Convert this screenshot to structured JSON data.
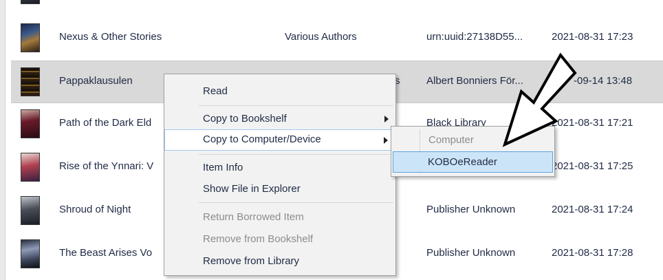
{
  "rows": [
    {
      "title": "Nexus & Other Stories",
      "author": "Various Authors",
      "publisher": "urn:uuid:27138D55...",
      "date": "2021-08-31 17:23"
    },
    {
      "title": "Pappaklausulen",
      "author": "s",
      "publisher": "Albert Bonniers För...",
      "date": "-09-14 13:48"
    },
    {
      "title": "Path of the Dark Eld",
      "author": "",
      "publisher": "Black Library",
      "date": "2021-08-31 17:21"
    },
    {
      "title": "Rise of the Ynnari: V",
      "author": "",
      "publisher": "",
      "date": "2021-08-31 17:25"
    },
    {
      "title": "Shroud of Night",
      "author": "",
      "publisher": "Publisher Unknown",
      "date": "2021-08-31 17:24"
    },
    {
      "title": "The Beast Arises Vo",
      "author": "",
      "publisher": "Publisher Unknown",
      "date": "2021-08-31 17:28"
    }
  ],
  "context_menu": {
    "items": [
      {
        "label": "Read"
      },
      {
        "label": "Copy to Bookshelf"
      },
      {
        "label": "Copy to Computer/Device"
      },
      {
        "label": "Item Info"
      },
      {
        "label": "Show File in Explorer"
      },
      {
        "label": "Return Borrowed Item"
      },
      {
        "label": "Remove from Bookshelf"
      },
      {
        "label": "Remove from Library"
      }
    ]
  },
  "submenu": {
    "items": [
      {
        "label": "Computer"
      },
      {
        "label": "KOBOeReader"
      }
    ]
  },
  "colors": {
    "highlight": "#cce4f7",
    "highlight_border": "#5aa3e0",
    "selected_row": "#d9d9d9"
  }
}
